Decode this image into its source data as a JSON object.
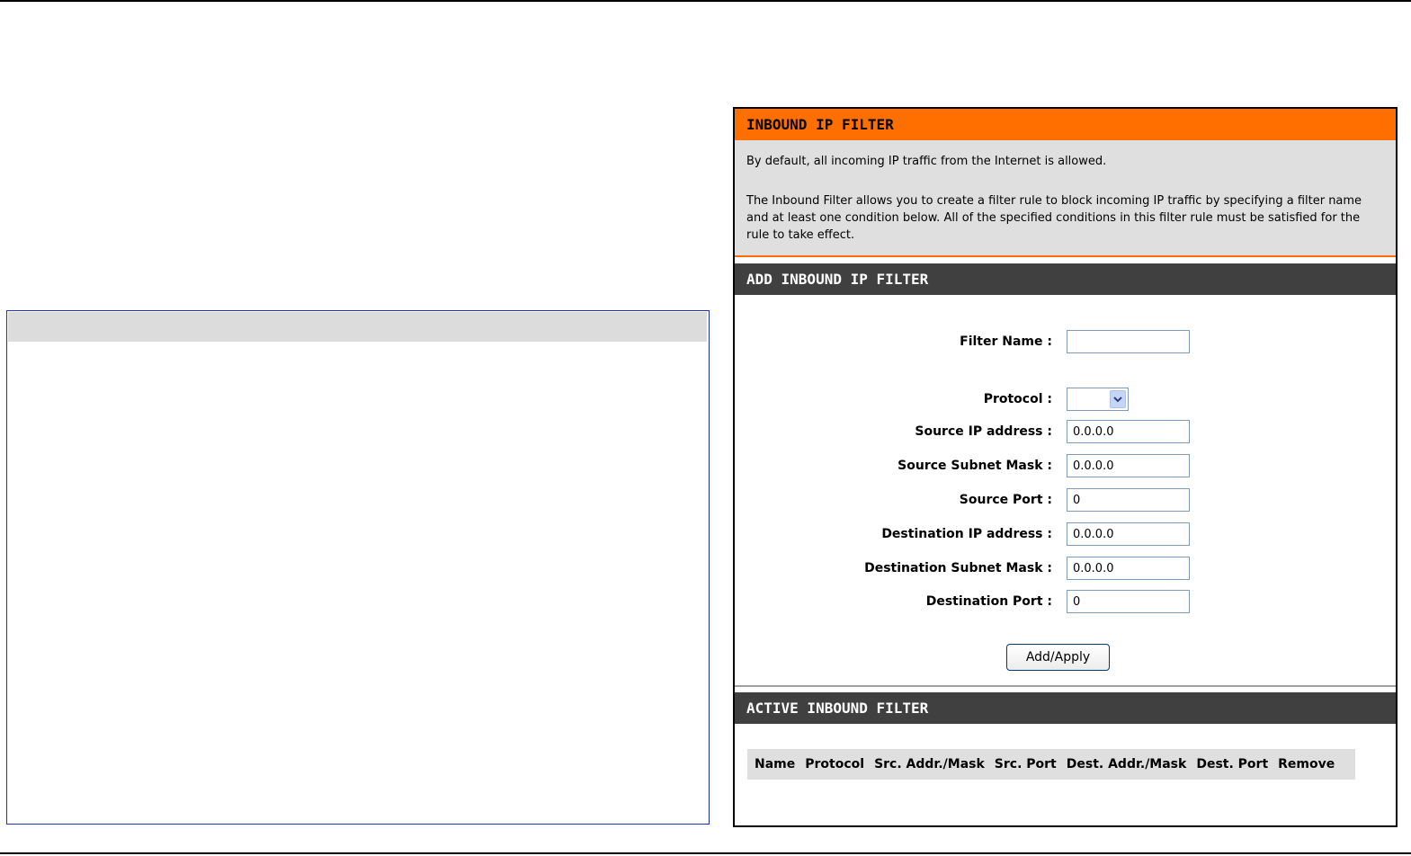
{
  "panel": {
    "title": "INBOUND IP FILTER",
    "intro_line1": "By default, all incoming IP traffic from the Internet is allowed.",
    "intro_line2": "The Inbound Filter allows you to create a filter rule to block incoming IP traffic by specifying a filter name and at least one condition below. All of the specified conditions in this filter rule must be satisfied for the rule to take effect."
  },
  "add_section": {
    "title": "ADD INBOUND IP FILTER",
    "fields": {
      "filter_name": {
        "label": "Filter Name :",
        "value": ""
      },
      "protocol": {
        "label": "Protocol :",
        "value": ""
      },
      "source_ip": {
        "label": "Source IP address :",
        "value": "0.0.0.0"
      },
      "source_mask": {
        "label": "Source Subnet Mask :",
        "value": "0.0.0.0"
      },
      "source_port": {
        "label": "Source Port :",
        "value": "0"
      },
      "dest_ip": {
        "label": "Destination IP address :",
        "value": "0.0.0.0"
      },
      "dest_mask": {
        "label": "Destination Subnet Mask :",
        "value": "0.0.0.0"
      },
      "dest_port": {
        "label": "Destination Port :",
        "value": "0"
      }
    },
    "apply_label": "Add/Apply"
  },
  "active_section": {
    "title": "ACTIVE INBOUND FILTER",
    "columns": [
      "Name",
      "Protocol",
      "Src. Addr./Mask",
      "Src. Port",
      "Dest. Addr./Mask",
      "Dest. Port",
      "Remove"
    ]
  },
  "colors": {
    "accent_orange": "#ff6f00",
    "header_dark": "#404040",
    "intro_gray": "#dfdfdf",
    "left_box_border": "#1f2fb8"
  },
  "icons": {
    "protocol_dropdown": "chevron-down-icon"
  }
}
